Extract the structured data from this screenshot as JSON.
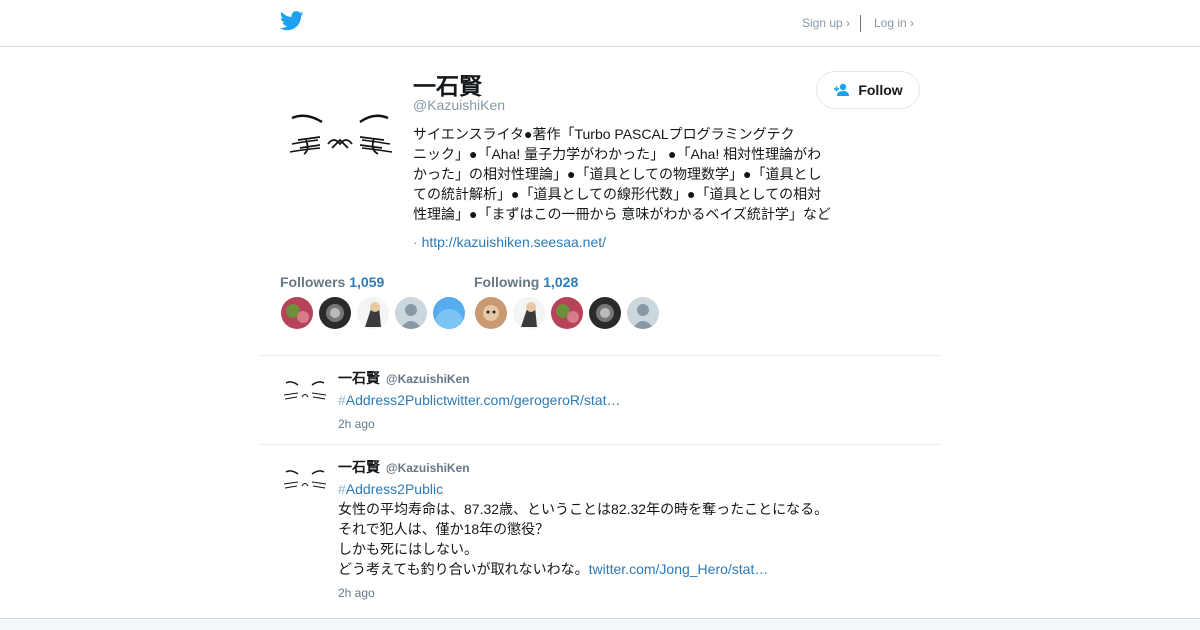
{
  "nav": {
    "signup_label": "Sign up ›",
    "login_label": "Log in ›",
    "logo_icon": "twitter-bird-icon"
  },
  "profile": {
    "name": "一石賢",
    "handle": "@KazuishiKen",
    "follow_label": "Follow",
    "bio": [
      "サイエンスライタ●著作「Turbo PASCALプログラミングテク",
      "ニック」●「Aha! 量子力学がわかった」 ●「Aha! 相対性理論がわ",
      "かった」の相対性理論」●「道具としての物理数学」●「道具とし",
      "ての統計解析」●「道具としての線形代数」●「道具としての相対",
      "性理論」●「まずはこの一冊から 意味がわかるベイズ統計学」など"
    ],
    "url_prefix": "·",
    "url": "http://kazuishiken.seesaa.net/"
  },
  "followers": {
    "label": "Followers",
    "count": "1,059"
  },
  "following": {
    "label": "Following",
    "count": "1,028"
  },
  "tweets": [
    {
      "name": "一石賢",
      "handle": "@KazuishiKen",
      "hashtag_symbol": "#",
      "hashtag": "Address2Public",
      "link": "twitter.com/gerogeroR/stat…",
      "lines": [],
      "time": "2h ago"
    },
    {
      "name": "一石賢",
      "handle": "@KazuishiKen",
      "hashtag_symbol": "#",
      "hashtag": "Address2Public",
      "lines": [
        "女性の平均寿命は、87.32歳、ということは82.32年の時を奪ったことになる。",
        "それで犯人は、僅か18年の懲役？",
        "しかも死にはしない。",
        "どう考えても釣り合いが取れないわな。"
      ],
      "link": "twitter.com/Jong_Hero/stat…",
      "time": "2h ago"
    }
  ],
  "colors": {
    "accent": "#1da1f2",
    "link": "#2b7bb9",
    "muted": "#8899a6",
    "border": "#e6ecf0"
  }
}
